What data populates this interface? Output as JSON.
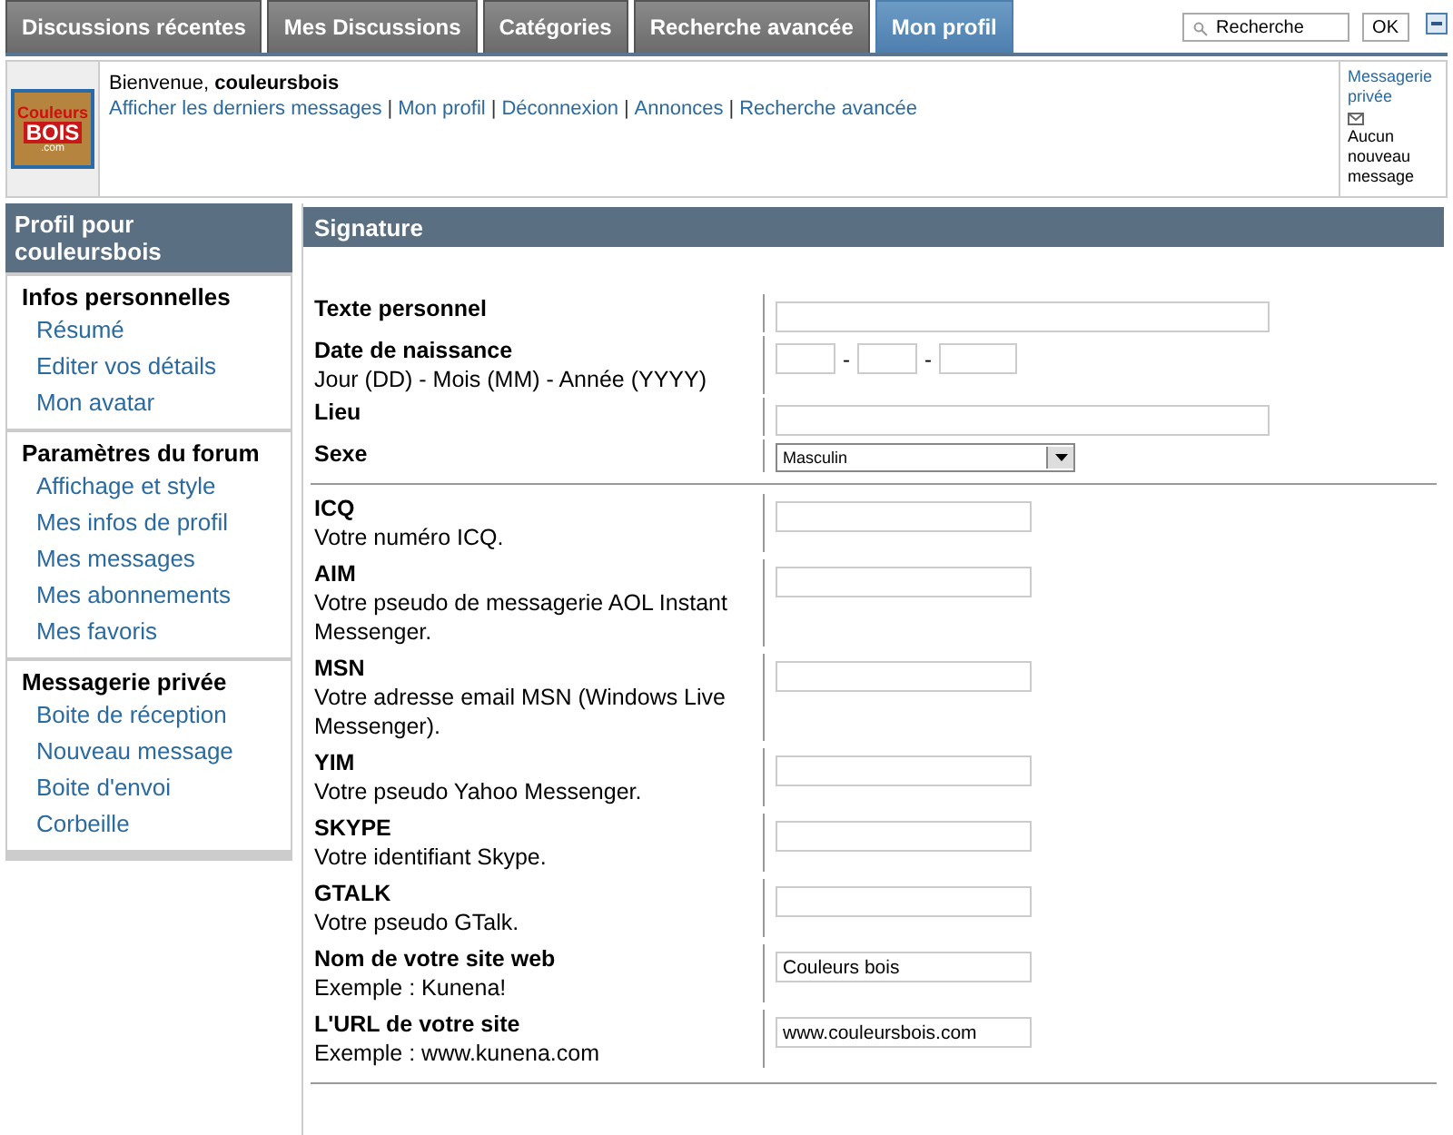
{
  "tabs": [
    {
      "label": "Discussions récentes",
      "selected": false
    },
    {
      "label": "Mes Discussions",
      "selected": false
    },
    {
      "label": "Catégories",
      "selected": false
    },
    {
      "label": "Recherche avancée",
      "selected": false
    },
    {
      "label": "Mon profil",
      "selected": true
    }
  ],
  "search": {
    "placeholder": "Recherche",
    "button": "OK"
  },
  "header": {
    "logo": [
      "Couleurs",
      "BOIS",
      ".com"
    ],
    "welcome": "Bienvenue, **couleursbois**",
    "separator": "|",
    "links": [
      "Afficher les derniers messages",
      "Mon profil",
      "Déconnexion",
      "Annonces",
      "Recherche avancée"
    ],
    "pm": {
      "link": "Messagerie privée",
      "text": "Aucun nouveau message"
    }
  },
  "sidebar": {
    "title": "Profil pour couleursbois",
    "groups": [
      {
        "title": "Infos personnelles",
        "items": [
          "Résumé",
          "Editer vos détails",
          "Mon avatar"
        ]
      },
      {
        "title": "Paramètres du forum",
        "items": [
          "Affichage et style",
          "Mes infos de profil",
          "Mes messages",
          "Mes abonnements",
          "Mes favoris"
        ]
      },
      {
        "title": "Messagerie privée",
        "items": [
          "Boite de réception",
          "Nouveau message",
          "Boite d'envoi",
          "Corbeille"
        ]
      }
    ]
  },
  "panel": {
    "title": "Signature",
    "sections": [
      [
        {
          "kind": "wide",
          "label": "Texte personnel"
        },
        {
          "kind": "date",
          "label": "Date de naissance",
          "hint": "Jour (DD) - Mois (MM) - Année (YYYY)",
          "separator": "-"
        },
        {
          "kind": "wide",
          "label": "Lieu"
        },
        {
          "kind": "select",
          "label": "Sexe",
          "value": "Masculin"
        }
      ],
      [
        {
          "kind": "text",
          "label": "ICQ",
          "hint": "Votre numéro ICQ."
        },
        {
          "kind": "text",
          "label": "AIM",
          "hint": "Votre pseudo de messagerie AOL Instant Messenger."
        },
        {
          "kind": "text",
          "label": "MSN",
          "hint": "Votre adresse email MSN (Windows Live Messenger)."
        },
        {
          "kind": "text",
          "label": "YIM",
          "hint": "Votre pseudo Yahoo Messenger."
        },
        {
          "kind": "text",
          "label": "SKYPE",
          "hint": "Votre identifiant Skype."
        },
        {
          "kind": "text",
          "label": "GTALK",
          "hint": "Votre pseudo GTalk."
        },
        {
          "kind": "text",
          "label": "Nom de votre site web",
          "hint": "Exemple : Kunena!",
          "value": "Couleurs bois"
        },
        {
          "kind": "text",
          "label": "L'URL de votre site",
          "hint": "Exemple : www.kunena.com",
          "value": "www.couleursbois.com"
        }
      ]
    ]
  }
}
